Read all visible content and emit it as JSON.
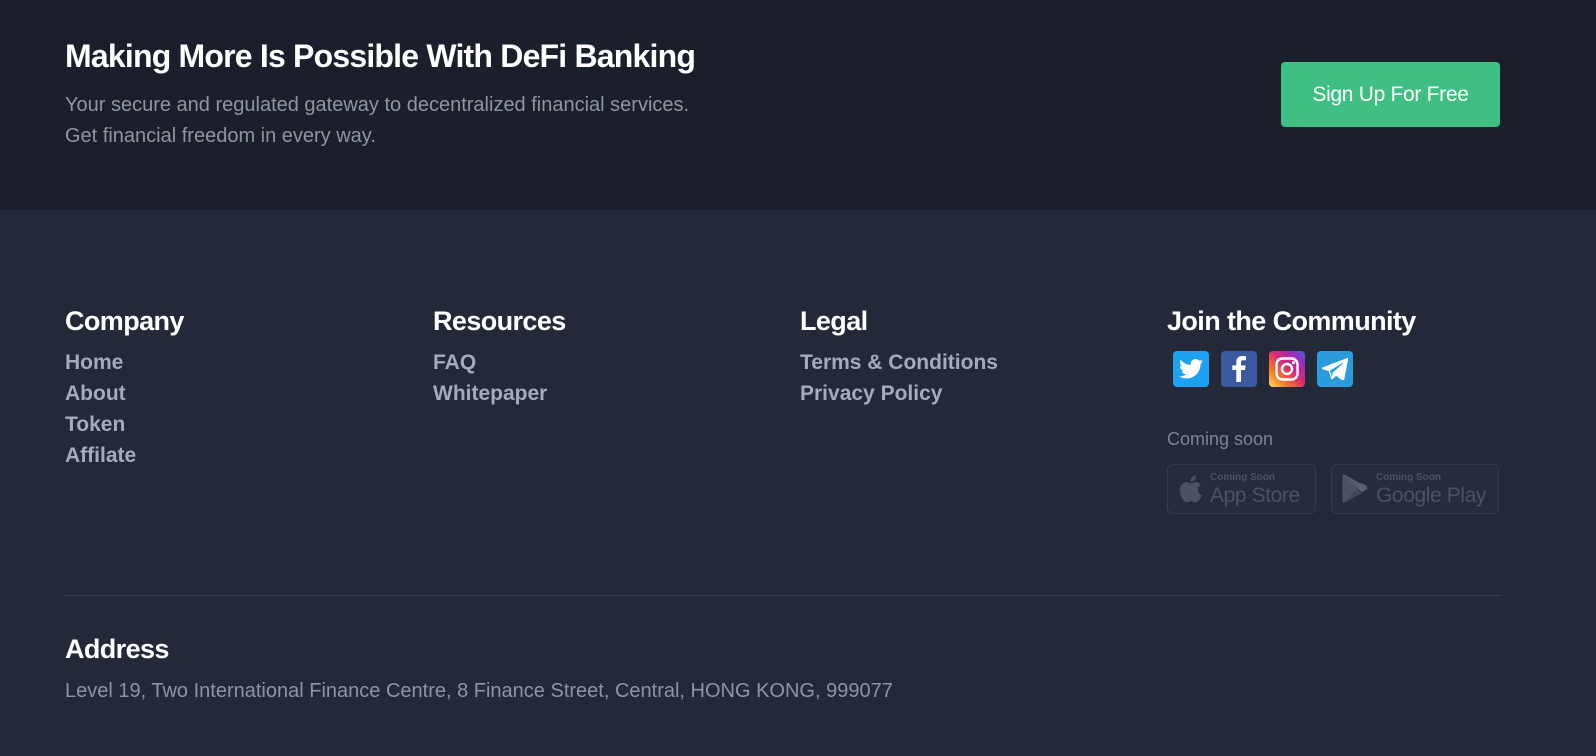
{
  "cta": {
    "title": "Making More Is Possible With DeFi Banking",
    "subtitle_line1": "Your secure and regulated gateway to decentralized financial services.",
    "subtitle_line2": "Get financial freedom in every way.",
    "signup_label": "Sign Up For Free",
    "accent_color": "#3fbf83"
  },
  "footer": {
    "company": {
      "heading": "Company",
      "links": [
        "Home",
        "About",
        "Token",
        "Affilate"
      ]
    },
    "resources": {
      "heading": "Resources",
      "links": [
        "FAQ",
        "Whitepaper"
      ]
    },
    "legal": {
      "heading": "Legal",
      "links": [
        "Terms & Conditions",
        "Privacy Policy"
      ]
    },
    "community": {
      "heading": "Join the Community",
      "social_icons": [
        "twitter-icon",
        "facebook-icon",
        "instagram-icon",
        "telegram-icon"
      ],
      "coming_soon": "Coming soon",
      "app_store": {
        "small": "Coming Soon",
        "big": "App Store",
        "icon": "apple-icon"
      },
      "google_play": {
        "small": "Coming Soon",
        "big": "Google Play",
        "icon": "google-play-icon"
      }
    },
    "address": {
      "heading": "Address",
      "text": "Level 19, Two International Finance Centre, 8 Finance Street, Central, HONG KONG, 999077"
    }
  }
}
